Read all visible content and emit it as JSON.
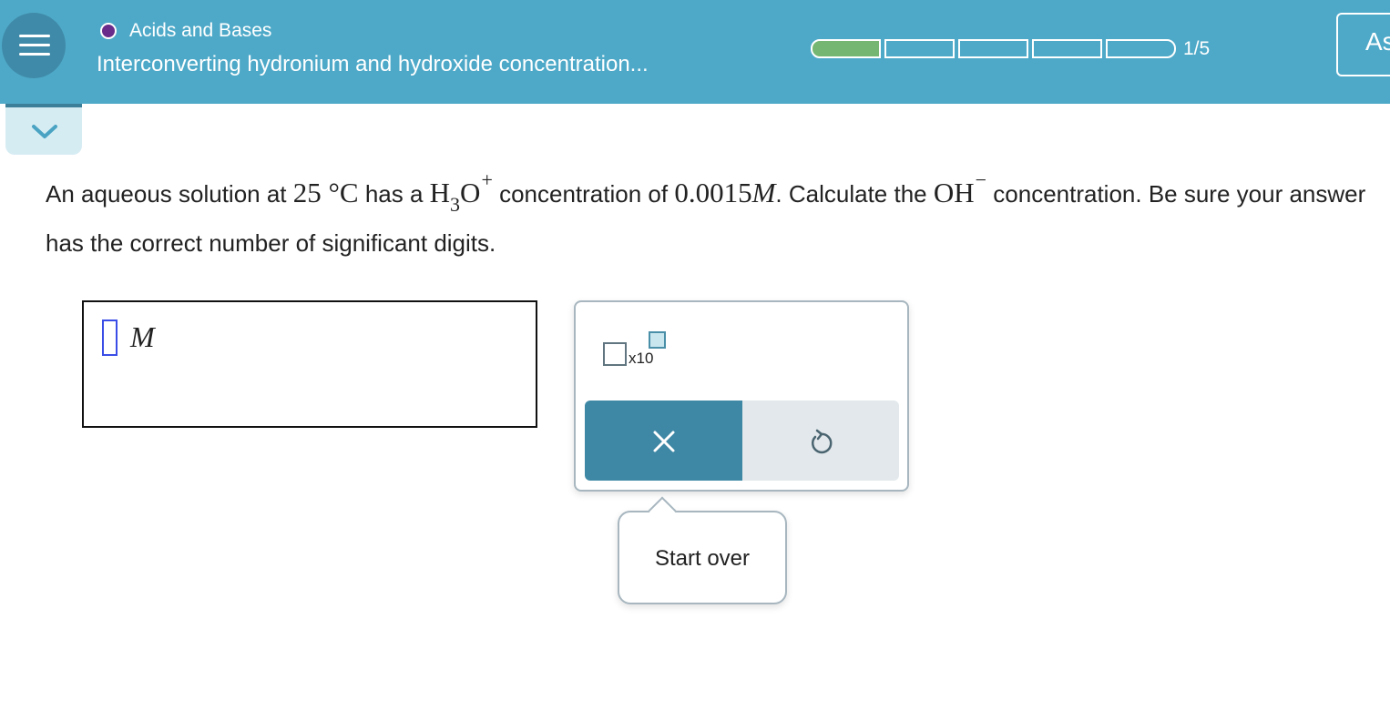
{
  "header": {
    "topic": "Acids and Bases",
    "title": "Interconverting hydronium and hydroxide concentration...",
    "progress_text": "1/5",
    "progress_value": 0.2,
    "progress_segments": 5,
    "progress_filled": 1,
    "ask_label": "Ask",
    "menu_icon": "hamburger-menu-icon",
    "topic_dot_color": "#6a2c8a"
  },
  "question": {
    "part1": "An aqueous solution at ",
    "temp": "25 °C",
    "part2": " has a ",
    "species1_base": "H",
    "species1_sub": "3",
    "species1_base2": "O",
    "species1_charge": "+",
    "part3": " concentration of ",
    "conc_value": "0.0015",
    "conc_unit": "M",
    "part4": ". Calculate the ",
    "species2": "OH",
    "species2_charge": "−",
    "part5": " concentration. Be sure your answer",
    "line2": "has the correct number of significant digits."
  },
  "answer": {
    "unit": "M"
  },
  "tools": {
    "sci_label": "x10",
    "clear_icon": "close-icon",
    "undo_icon": "undo-icon",
    "clear_color": "#3e88a5"
  },
  "tooltip": {
    "label": "Start over"
  }
}
